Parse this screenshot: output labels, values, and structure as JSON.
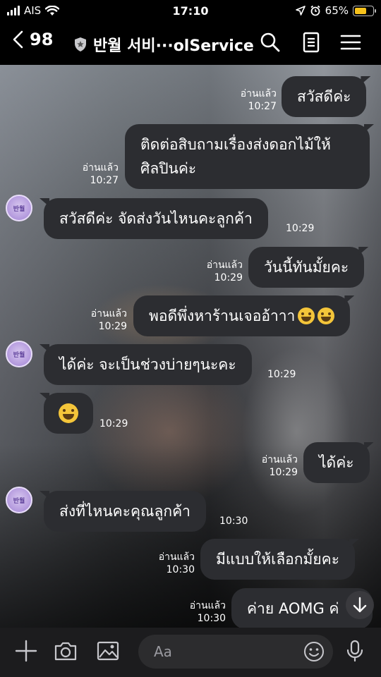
{
  "status_bar": {
    "carrier": "AIS",
    "time": "17:10",
    "battery_percent": "65%",
    "battery_level": 0.65,
    "icons": [
      "signal-icon",
      "wifi-icon",
      "location-icon",
      "alarm-icon",
      "battery-icon"
    ]
  },
  "header": {
    "back_count": "98",
    "chat_title": "반월 서비···olService",
    "icons": [
      "back-icon",
      "shield-icon",
      "search-icon",
      "notes-icon",
      "menu-icon"
    ]
  },
  "messages": [
    {
      "side": "out",
      "text": "สวัสดีค่ะ",
      "read": "อ่านแล้ว",
      "time": "10:27"
    },
    {
      "side": "out",
      "lines": [
        "ติดต่อสิบถามเรื่องส่งดอกไม้ให้",
        "ศิลปินค่ะ"
      ],
      "read": "อ่านแล้ว",
      "time": "10:27"
    },
    {
      "side": "in",
      "text": "สวัสดีค่ะ จัดส่งวันไหนคะลูกค้า",
      "time": "10:29"
    },
    {
      "side": "out",
      "text": "วันนี้ทันมั้ยคะ",
      "read": "อ่านแล้ว",
      "time": "10:29"
    },
    {
      "side": "out",
      "text": "พอดีพึ่งหาร้านเจออ้าาา",
      "emojis": 2,
      "read": "อ่านแล้ว",
      "time": "10:29"
    },
    {
      "side": "in",
      "text": "ได้ค่ะ จะเป็นช่วงบ่ายๆนะคะ",
      "time": "10:29"
    },
    {
      "side": "in",
      "emoji_only": true,
      "time": "10:29"
    },
    {
      "side": "out",
      "text": "ได้ค่ะ",
      "read": "อ่านแล้ว",
      "time": "10:29"
    },
    {
      "side": "in",
      "text": "ส่งที่ไหนคะคุณลูกค้า",
      "time": "10:30"
    },
    {
      "side": "out",
      "text": "มีแบบให้เลือกมั้ยคะ",
      "read": "อ่านแล้ว",
      "time": "10:30"
    },
    {
      "side": "out",
      "text": "ค่าย AOMG ค่",
      "read": "อ่านแล้ว",
      "time": "10:30"
    }
  ],
  "avatar_label": "반월",
  "input_bar": {
    "placeholder": "Aa",
    "icons": [
      "plus-icon",
      "camera-icon",
      "image-icon",
      "emoji-icon",
      "microphone-icon"
    ]
  },
  "colors": {
    "bubble": "#2c2d31",
    "header": "#000000",
    "battery": "#f7c21b",
    "avatar": "#b89fe0"
  }
}
